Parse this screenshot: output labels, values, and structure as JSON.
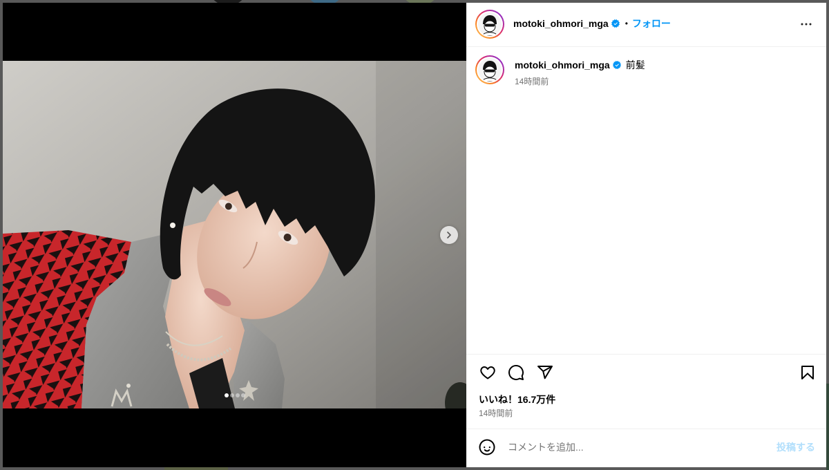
{
  "post": {
    "header": {
      "username": "motoki_ohmori_mga",
      "separator": "•",
      "follow_label": "フォロー"
    },
    "caption": {
      "username": "motoki_ohmori_mga",
      "text": "前髪",
      "time": "14時間前"
    },
    "likes_label": "いいね！16.7万件",
    "time": "14時間前",
    "comment_box": {
      "placeholder": "コメントを追加...",
      "submit_label": "投稿する"
    },
    "media": {
      "slide_count": 4,
      "active_slide": 1
    }
  },
  "icons": {
    "verified": "verified-badge-icon",
    "more": "more-horizontal-icon",
    "like": "heart-icon",
    "comment": "comment-icon",
    "share": "send-icon",
    "save": "bookmark-icon",
    "emoji": "emoji-icon",
    "next_slide": "chevron-right-icon"
  },
  "colors": {
    "accent": "#0095f6",
    "submit_disabled": "#b2dffc",
    "text_primary": "#000000",
    "text_secondary": "#737373",
    "divider": "#efefef",
    "overlay": "#595959",
    "media_background": "#000000"
  }
}
